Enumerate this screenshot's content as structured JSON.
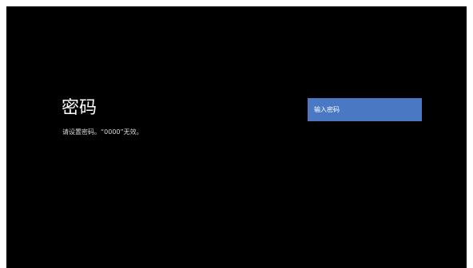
{
  "page": {
    "title": "密码",
    "subtitle": "请设置密码。“0000”无效。"
  },
  "password_field": {
    "placeholder": "输入密码",
    "value": ""
  },
  "colors": {
    "background": "#000000",
    "input_background": "#4a78c2",
    "text": "#ffffff"
  }
}
